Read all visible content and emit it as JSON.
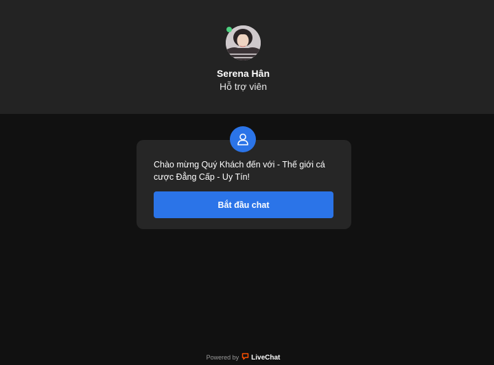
{
  "agent": {
    "name": "Serena Hân",
    "role": "Hỗ trợ viên",
    "status_color": "#4dd180"
  },
  "welcome": {
    "icon": "user-icon",
    "message": "Chào mừng Quý Khách đến với        - Thế giới cá cược Đẳng Cấp - Uy Tín!",
    "button_label": "Bắt đầu chat"
  },
  "footer": {
    "powered_by": "Powered by",
    "brand": "LiveChat",
    "brand_icon": "livechat-icon"
  },
  "colors": {
    "accent": "#2b74e8",
    "brand": "#ff5100",
    "header_bg": "#232323",
    "page_bg": "#111111",
    "card_bg": "#262626"
  }
}
